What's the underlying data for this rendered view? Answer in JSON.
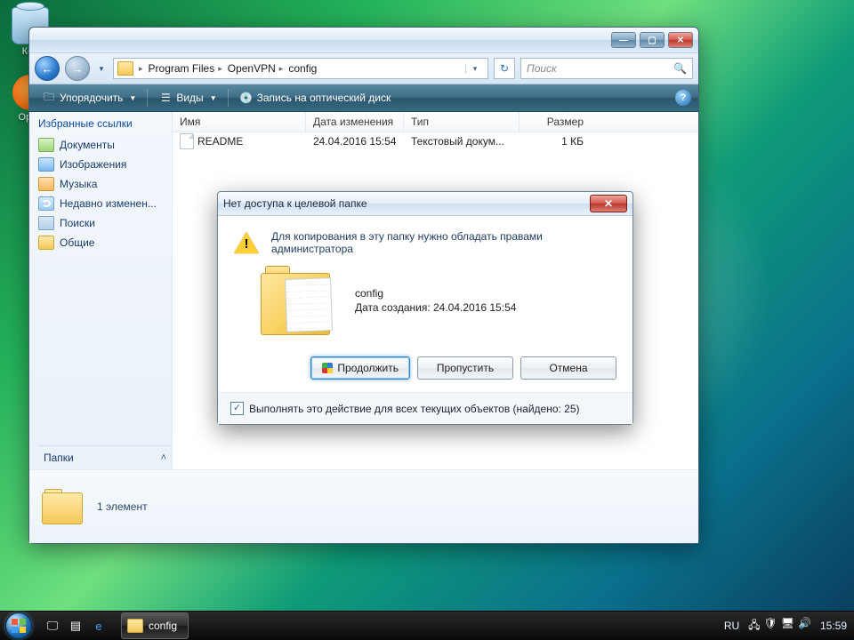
{
  "desktop": {
    "icons": [
      {
        "name": "recycle-bin",
        "label": "Кор"
      },
      {
        "name": "openvpn",
        "label": "Open"
      }
    ]
  },
  "explorer": {
    "nav": {
      "crumbs": [
        "Program Files",
        "OpenVPN",
        "config"
      ],
      "search_placeholder": "Поиск"
    },
    "commands": {
      "organize": "Упорядочить",
      "views": "Виды",
      "burn": "Запись на оптический диск"
    },
    "fav_header": "Избранные ссылки",
    "fav": [
      {
        "icon": "ic-doc",
        "label": "Документы"
      },
      {
        "icon": "ic-img",
        "label": "Изображения"
      },
      {
        "icon": "ic-mus",
        "label": "Музыка"
      },
      {
        "icon": "ic-rec",
        "label": "Недавно изменен..."
      },
      {
        "icon": "ic-srch",
        "label": "Поиски"
      },
      {
        "icon": "ic-fold",
        "label": "Общие"
      }
    ],
    "folders_label": "Папки",
    "columns": {
      "name": "Имя",
      "date": "Дата изменения",
      "type": "Тип",
      "size": "Размер"
    },
    "rows": [
      {
        "name": "README",
        "date": "24.04.2016 15:54",
        "type": "Текстовый докум...",
        "size": "1 КБ"
      }
    ],
    "details": {
      "count": "1 элемент"
    }
  },
  "dialog": {
    "title": "Нет доступа к целевой папке",
    "message": "Для копирования в эту папку нужно обладать правами администратора",
    "obj_name": "config",
    "obj_date": "Дата создания: 24.04.2016 15:54",
    "btn_continue": "Продолжить",
    "btn_skip": "Пропустить",
    "btn_cancel": "Отмена",
    "checkbox": "Выполнять это действие для всех текущих объектов (найдено: 25)"
  },
  "taskbar": {
    "task_label": "config",
    "lang": "RU",
    "clock": "15:59"
  }
}
